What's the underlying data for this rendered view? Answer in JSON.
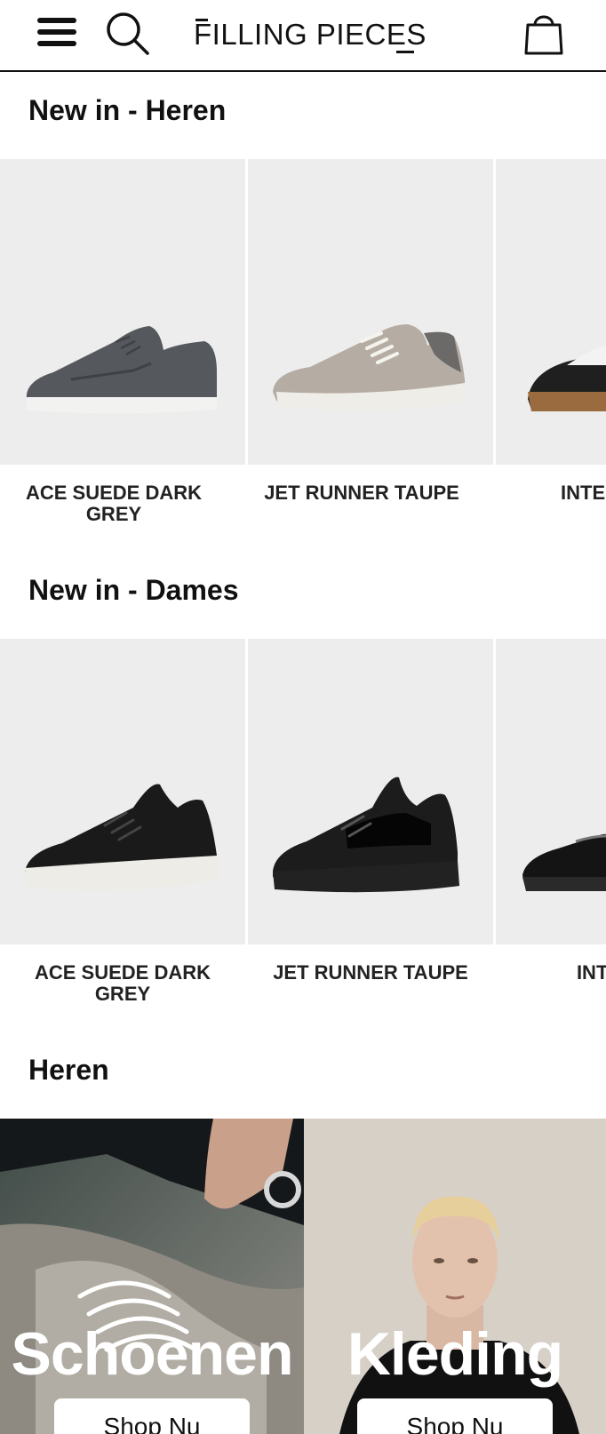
{
  "header": {
    "logo_text": "FILLING PIECES",
    "menu_icon": "hamburger-menu-icon",
    "search_icon": "search-icon",
    "bag_icon": "shopping-bag-icon"
  },
  "sections": {
    "new_men": {
      "title": "New in - Heren",
      "products": [
        {
          "name": "ACE SUEDE DARK GREY"
        },
        {
          "name": "JET RUNNER TAUPE"
        },
        {
          "name": "INTER DIC"
        }
      ]
    },
    "new_women": {
      "title": "New in - Dames",
      "products": [
        {
          "name": "ACE SUEDE DARK GREY"
        },
        {
          "name": "JET RUNNER TAUPE"
        },
        {
          "name": "INTER DI"
        }
      ]
    },
    "men": {
      "title": "Heren",
      "tiles": [
        {
          "label": "Schoenen",
          "button": "Shop Nu"
        },
        {
          "label": "Kleding",
          "button": "Shop Nu"
        }
      ]
    }
  },
  "colors": {
    "product_bg": "#ededed",
    "text": "#111111",
    "button_bg": "#ffffff"
  }
}
